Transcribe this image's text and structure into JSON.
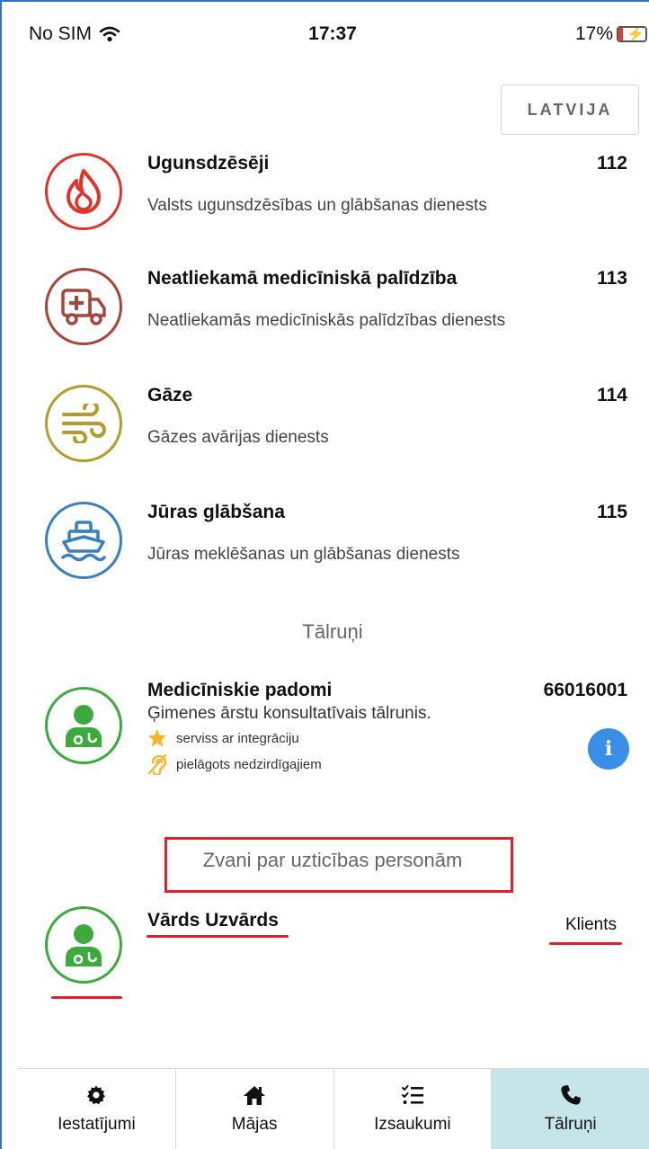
{
  "status": {
    "carrier": "No SIM",
    "time": "17:37",
    "battery": "17%",
    "battery_level": 0.17
  },
  "country_button": "LATVIJA",
  "services": [
    {
      "name": "Ugunsdzēsēji",
      "number": "112",
      "description": "Valsts ugunsdzēsības un glābšanas dienests",
      "icon": "fire-icon",
      "color": "#e0342b"
    },
    {
      "name": "Neatliekamā medicīniskā palīdzība",
      "number": "113",
      "description": "Neatliekamās medicīniskās palīdzības dienests",
      "icon": "ambulance-icon",
      "color": "#a8453a"
    },
    {
      "name": "Gāze",
      "number": "114",
      "description": "Gāzes avārijas dienests",
      "icon": "wind-icon",
      "color": "#b59a2c"
    },
    {
      "name": "Jūras glābšana",
      "number": "115",
      "description": "Jūras meklēšanas un glābšanas dienests",
      "icon": "ship-icon",
      "color": "#3a7fc2"
    }
  ],
  "phones_section_title": "Tālruņi",
  "medical_advice": {
    "name": "Medicīniskie padomi",
    "number": "66016001",
    "description": "Ģimenes ārstu konsultatīvais tālrunis.",
    "feature_integration": "serviss ar integrāciju",
    "feature_deaf": "pielāgots nedzirdīgajiem"
  },
  "trusted_section_title": "Zvani par uzticības personām",
  "trusted_contact": {
    "name": "Vārds Uzvārds",
    "role": "Klients"
  },
  "tabs": [
    {
      "label": "Iestatījumi",
      "icon": "gear-icon"
    },
    {
      "label": "Mājas",
      "icon": "home-icon"
    },
    {
      "label": "Izsaukumi",
      "icon": "checklist-icon"
    },
    {
      "label": "Tālruņi",
      "icon": "phone-icon",
      "active": true
    }
  ],
  "colors": {
    "accent_green": "#3daa3d",
    "info_blue": "#3a8ee6",
    "annotation_red": "#e0202a",
    "active_tab": "#c6e5e8"
  }
}
